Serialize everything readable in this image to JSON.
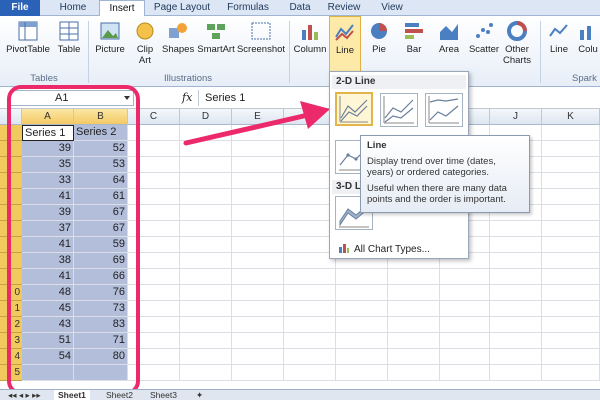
{
  "tabs": [
    "File",
    "Home",
    "Insert",
    "Page Layout",
    "Formulas",
    "Data",
    "Review",
    "View"
  ],
  "ribbon": {
    "buttons": [
      "PivotTable",
      "Table",
      "Picture",
      "Clip Art",
      "Shapes",
      "SmartArt",
      "Screenshot",
      "Column",
      "Line",
      "Pie",
      "Bar",
      "Area",
      "Scatter",
      "Other Charts",
      "Line",
      "Colu"
    ],
    "groups": [
      "Tables",
      "Illustrations",
      "Spark"
    ]
  },
  "formula_bar": {
    "name_box": "A1",
    "fx": "fx",
    "content": "Series 1"
  },
  "columns": [
    "A",
    "B",
    "C",
    "D",
    "E",
    "F",
    "G",
    "H",
    "I",
    "J",
    "K"
  ],
  "row_numbers": [
    "",
    "",
    "",
    "",
    "",
    "",
    "",
    "",
    "",
    "",
    "0",
    "1",
    "2",
    "3",
    "4",
    "5"
  ],
  "headers": [
    "Series 1",
    "Series 2"
  ],
  "series1": [
    "39",
    "35",
    "33",
    "41",
    "39",
    "37",
    "41",
    "38",
    "41",
    "48",
    "45",
    "43",
    "51",
    "54"
  ],
  "series2": [
    "52",
    "53",
    "64",
    "61",
    "67",
    "67",
    "59",
    "69",
    "66",
    "76",
    "73",
    "83",
    "71",
    "80"
  ],
  "dropdown": {
    "section1": "2-D Line",
    "section2": "3-D Li",
    "all_chart_types": "All Chart Types..."
  },
  "tooltip": {
    "title": "Line",
    "p1": "Display trend over time (dates, years) or ordered categories.",
    "p2": "Useful when there are many data points and the order is important."
  },
  "sheets": [
    "Sheet1",
    "Sheet2",
    "Sheet3"
  ],
  "colors": {
    "highlight": "#ec2a6b",
    "selection": "#b3bedb",
    "file_tab": "#2a62b8"
  }
}
